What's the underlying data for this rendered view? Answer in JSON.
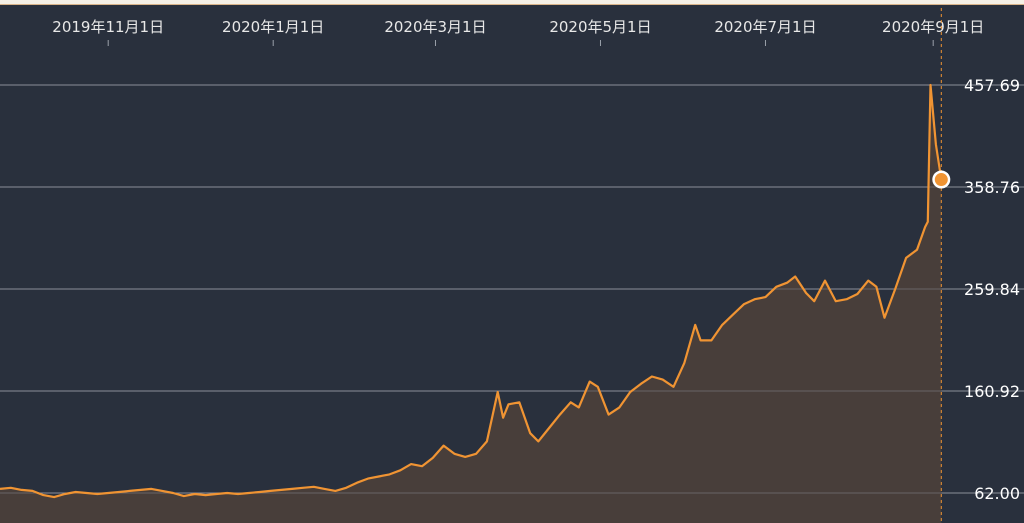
{
  "chart_data": {
    "type": "area",
    "title": "",
    "xlabel": "",
    "ylabel": "",
    "x_ticks": [
      "2019年11月1日",
      "2020年1月1日",
      "2020年3月1日",
      "2020年5月1日",
      "2020年7月1日",
      "2020年9月1日"
    ],
    "y_ticks": [
      "62.00",
      "160.92",
      "259.84",
      "358.76",
      "457.69"
    ],
    "ylim": [
      62.0,
      457.69
    ],
    "xlim": [
      "2019-09-22",
      "2020-09-05"
    ],
    "grid": true,
    "legend": "none",
    "colors": {
      "background": "#29303d",
      "line": "#f09433",
      "area": "#4a3f3a",
      "grid": "#8a8f99",
      "text": "#ffffff",
      "top_band": "#f5f0e6"
    },
    "series": [
      {
        "values": [
          [
            "2019-09-22",
            66
          ],
          [
            "2019-09-26",
            67
          ],
          [
            "2019-09-30",
            65
          ],
          [
            "2019-10-04",
            64
          ],
          [
            "2019-10-08",
            60
          ],
          [
            "2019-10-12",
            58
          ],
          [
            "2019-10-16",
            61
          ],
          [
            "2019-10-20",
            63
          ],
          [
            "2019-10-24",
            62
          ],
          [
            "2019-10-28",
            61
          ],
          [
            "2019-11-01",
            62
          ],
          [
            "2019-11-05",
            63
          ],
          [
            "2019-11-09",
            64
          ],
          [
            "2019-11-13",
            65
          ],
          [
            "2019-11-17",
            66
          ],
          [
            "2019-11-21",
            64
          ],
          [
            "2019-11-25",
            62
          ],
          [
            "2019-11-29",
            59
          ],
          [
            "2019-12-03",
            61
          ],
          [
            "2019-12-07",
            60
          ],
          [
            "2019-12-11",
            61
          ],
          [
            "2019-12-15",
            62
          ],
          [
            "2019-12-19",
            61
          ],
          [
            "2019-12-23",
            62
          ],
          [
            "2019-12-27",
            63
          ],
          [
            "2019-12-31",
            64
          ],
          [
            "2020-01-04",
            65
          ],
          [
            "2020-01-08",
            66
          ],
          [
            "2020-01-12",
            67
          ],
          [
            "2020-01-16",
            68
          ],
          [
            "2020-01-20",
            66
          ],
          [
            "2020-01-24",
            64
          ],
          [
            "2020-01-28",
            67
          ],
          [
            "2020-02-01",
            72
          ],
          [
            "2020-02-05",
            76
          ],
          [
            "2020-02-09",
            78
          ],
          [
            "2020-02-13",
            80
          ],
          [
            "2020-02-17",
            84
          ],
          [
            "2020-02-21",
            90
          ],
          [
            "2020-02-25",
            88
          ],
          [
            "2020-02-29",
            96
          ],
          [
            "2020-03-04",
            108
          ],
          [
            "2020-03-08",
            100
          ],
          [
            "2020-03-12",
            97
          ],
          [
            "2020-03-16",
            100
          ],
          [
            "2020-03-20",
            112
          ],
          [
            "2020-03-24",
            160
          ],
          [
            "2020-03-26",
            135
          ],
          [
            "2020-03-28",
            148
          ],
          [
            "2020-04-01",
            150
          ],
          [
            "2020-04-05",
            120
          ],
          [
            "2020-04-08",
            112
          ],
          [
            "2020-04-12",
            125
          ],
          [
            "2020-04-16",
            138
          ],
          [
            "2020-04-20",
            150
          ],
          [
            "2020-04-23",
            145
          ],
          [
            "2020-04-27",
            170
          ],
          [
            "2020-04-30",
            165
          ],
          [
            "2020-05-04",
            138
          ],
          [
            "2020-05-08",
            145
          ],
          [
            "2020-05-12",
            160
          ],
          [
            "2020-05-16",
            168
          ],
          [
            "2020-05-20",
            175
          ],
          [
            "2020-05-24",
            172
          ],
          [
            "2020-05-28",
            165
          ],
          [
            "2020-06-01",
            188
          ],
          [
            "2020-06-05",
            225
          ],
          [
            "2020-06-07",
            210
          ],
          [
            "2020-06-11",
            210
          ],
          [
            "2020-06-15",
            225
          ],
          [
            "2020-06-19",
            235
          ],
          [
            "2020-06-23",
            245
          ],
          [
            "2020-06-27",
            250
          ],
          [
            "2020-07-01",
            252
          ],
          [
            "2020-07-05",
            262
          ],
          [
            "2020-07-09",
            266
          ],
          [
            "2020-07-12",
            272
          ],
          [
            "2020-07-16",
            256
          ],
          [
            "2020-07-19",
            248
          ],
          [
            "2020-07-23",
            268
          ],
          [
            "2020-07-27",
            248
          ],
          [
            "2020-07-31",
            250
          ],
          [
            "2020-08-04",
            255
          ],
          [
            "2020-08-08",
            268
          ],
          [
            "2020-08-11",
            262
          ],
          [
            "2020-08-14",
            232
          ],
          [
            "2020-08-18",
            260
          ],
          [
            "2020-08-22",
            290
          ],
          [
            "2020-08-26",
            298
          ],
          [
            "2020-08-29",
            320
          ],
          [
            "2020-08-30",
            325
          ],
          [
            "2020-08-31",
            457.69
          ],
          [
            "2020-09-02",
            400
          ],
          [
            "2020-09-04",
            366
          ]
        ]
      }
    ],
    "last_point": [
      "2020-09-04",
      366
    ]
  }
}
